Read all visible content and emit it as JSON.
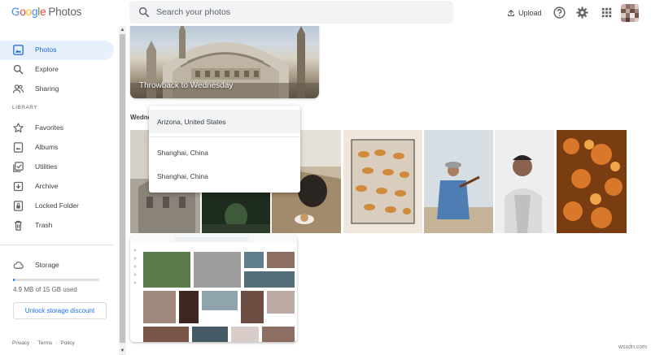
{
  "app": {
    "logo": {
      "letters": [
        "G",
        "o",
        "o",
        "g",
        "l",
        "e"
      ],
      "product": "Photos"
    }
  },
  "header": {
    "search_placeholder": "Search your photos",
    "upload_label": "Upload",
    "icons": [
      "help-icon",
      "settings-icon",
      "apps-grid-icon"
    ]
  },
  "sidebar": {
    "items": [
      {
        "label": "Photos",
        "icon": "photo-icon",
        "active": true
      },
      {
        "label": "Explore",
        "icon": "search-icon"
      },
      {
        "label": "Sharing",
        "icon": "people-icon"
      }
    ],
    "section_label": "LIBRARY",
    "library_items": [
      {
        "label": "Favorites",
        "icon": "star-icon"
      },
      {
        "label": "Albums",
        "icon": "album-icon"
      },
      {
        "label": "Utilities",
        "icon": "utilities-icon"
      },
      {
        "label": "Archive",
        "icon": "archive-icon"
      },
      {
        "label": "Locked Folder",
        "icon": "lock-folder-icon"
      },
      {
        "label": "Trash",
        "icon": "trash-icon"
      }
    ],
    "storage": {
      "label": "Storage",
      "usage_text": "4.9 MB of 15 GB used",
      "used_fraction": 0.02,
      "button_label": "Unlock storage discount"
    },
    "footer": {
      "privacy": "Privacy",
      "sep1": "·",
      "terms": "Terms",
      "sep2": "·",
      "policy": "Policy"
    }
  },
  "main": {
    "memory_title": "Throwback to Wednesday",
    "date_header": "Wedne",
    "location_menu": [
      {
        "label": "Arizona, United States",
        "hovered": true
      },
      {
        "label": "Shanghai, China"
      },
      {
        "label": "Shanghai, China"
      }
    ]
  },
  "watermark": "wsxdn.com",
  "colors": {
    "accent": "#1a73e8",
    "active_bg": "#e8f0fe",
    "text": "#3c4043"
  }
}
